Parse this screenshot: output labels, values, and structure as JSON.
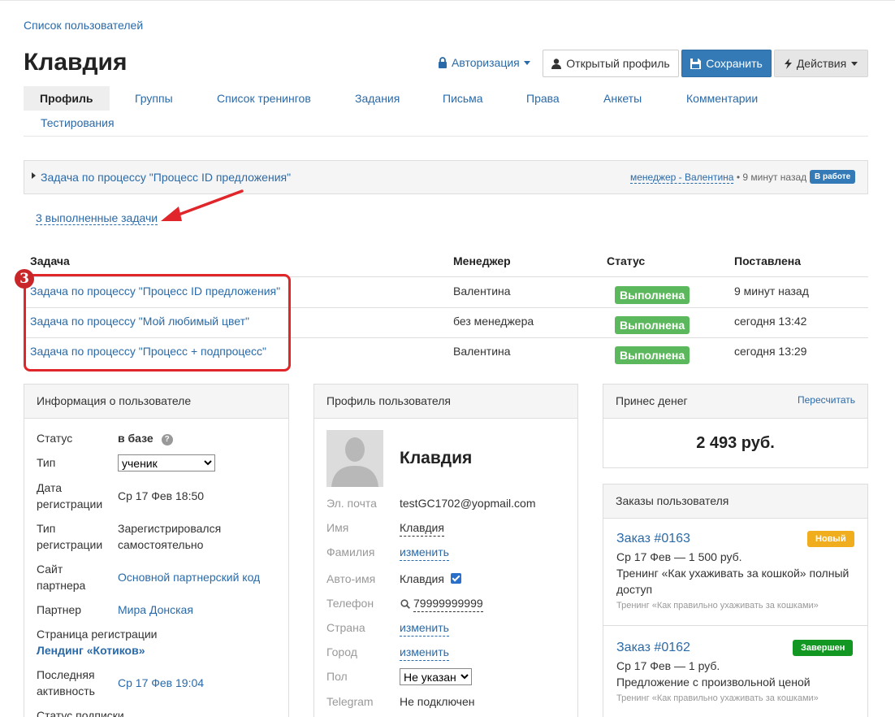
{
  "breadcrumb": "Список пользователей",
  "page_title": "Клавдия",
  "header": {
    "auth_label": "Авторизация",
    "open_profile_label": "Открытый профиль",
    "save_label": "Сохранить",
    "actions_label": "Действия"
  },
  "tabs": [
    "Профиль",
    "Группы",
    "Список тренингов",
    "Задания",
    "Письма",
    "Права",
    "Анкеты",
    "Комментарии",
    "Тестирования"
  ],
  "active_task": {
    "title": "Задача по процессу \"Процесс ID предложения\"",
    "manager": "менеджер - Валентина",
    "time": " • 9 минут назад",
    "status": "В работе"
  },
  "completed_link": "3 выполненные задачи",
  "tasks_table": {
    "headers": [
      "Задача",
      "Менеджер",
      "Статус",
      "Поставлена"
    ],
    "rows": [
      {
        "task": "Задача по процессу \"Процесс ID предложения\"",
        "manager": "Валентина",
        "status": "Выполнена",
        "created": "9 минут назад"
      },
      {
        "task": "Задача по процессу \"Мой любимый цвет\"",
        "manager": "без менеджера",
        "status": "Выполнена",
        "created": "сегодня 13:42"
      },
      {
        "task": "Задача по процессу \"Процесс + подпроцесс\"",
        "manager": "Валентина",
        "status": "Выполнена",
        "created": "сегодня 13:29"
      }
    ]
  },
  "annotation_number": "3",
  "user_info": {
    "title": "Информация о пользователе",
    "status_label": "Статус",
    "status_value": "в базе",
    "type_label": "Тип",
    "type_value": "ученик",
    "reg_date_label_1": "Дата",
    "reg_date_label_2": "регистрации",
    "reg_date_value": "Ср 17 Фев 18:50",
    "reg_type_label_1": "Тип",
    "reg_type_label_2": "регистрации",
    "reg_type_value_1": "Зарегистрировался",
    "reg_type_value_2": "самостоятельно",
    "partner_site_label_1": "Сайт",
    "partner_site_label_2": "партнера",
    "partner_site_value": "Основной партнерский код",
    "partner_label": "Партнер",
    "partner_value": "Мира Донская",
    "reg_page_label": "Страница регистрации",
    "reg_page_value": "Лендинг «Котиков»",
    "last_activity_label_1": "Последняя",
    "last_activity_label_2": "активность",
    "last_activity_value": "Ср 17 Фев 19:04",
    "subscription_label": "Статус подписки"
  },
  "user_profile": {
    "title": "Профиль пользователя",
    "name": "Клавдия",
    "email_label": "Эл. почта",
    "email_value": "testGC1702@yopmail.com",
    "first_name_label": "Имя",
    "first_name_value": "Клавдия",
    "last_name_label": "Фамилия",
    "last_name_value": "изменить",
    "auto_name_label": "Авто-имя",
    "auto_name_value": "Клавдия",
    "phone_label": "Телефон",
    "phone_value": "79999999999",
    "country_label": "Страна",
    "country_value": "изменить",
    "city_label": "Город",
    "city_value": "изменить",
    "gender_label": "Пол",
    "gender_value": "Не указан",
    "telegram_label": "Telegram",
    "telegram_value": "Не подключен"
  },
  "money": {
    "title": "Принес денег",
    "recalc_label": "Пересчитать",
    "amount": "2 493 руб."
  },
  "orders": {
    "title": "Заказы пользователя",
    "items": [
      {
        "number": "Заказ #0163",
        "badge": "Новый",
        "date_price": "Ср 17 Фев — 1 500 руб.",
        "desc_1": "Тренинг «Как ухаживать за кошкой» полный",
        "desc_2": "доступ",
        "training": "Тренинг «Как правильно ухаживать за кошками»"
      },
      {
        "number": "Заказ #0162",
        "badge": "Завершен",
        "date_price": "Ср 17 Фев — 1 руб.",
        "desc_1": "Предложение с произвольной ценой",
        "training": "Тренинг «Как правильно ухаживать за кошками»"
      }
    ]
  },
  "colors": {
    "link": "#2a6aa8",
    "primary": "#337ab7",
    "success": "#5cb85c",
    "annotation_red": "#e0262a",
    "badge_new": "#f0ad1e",
    "badge_finished": "#129822"
  }
}
